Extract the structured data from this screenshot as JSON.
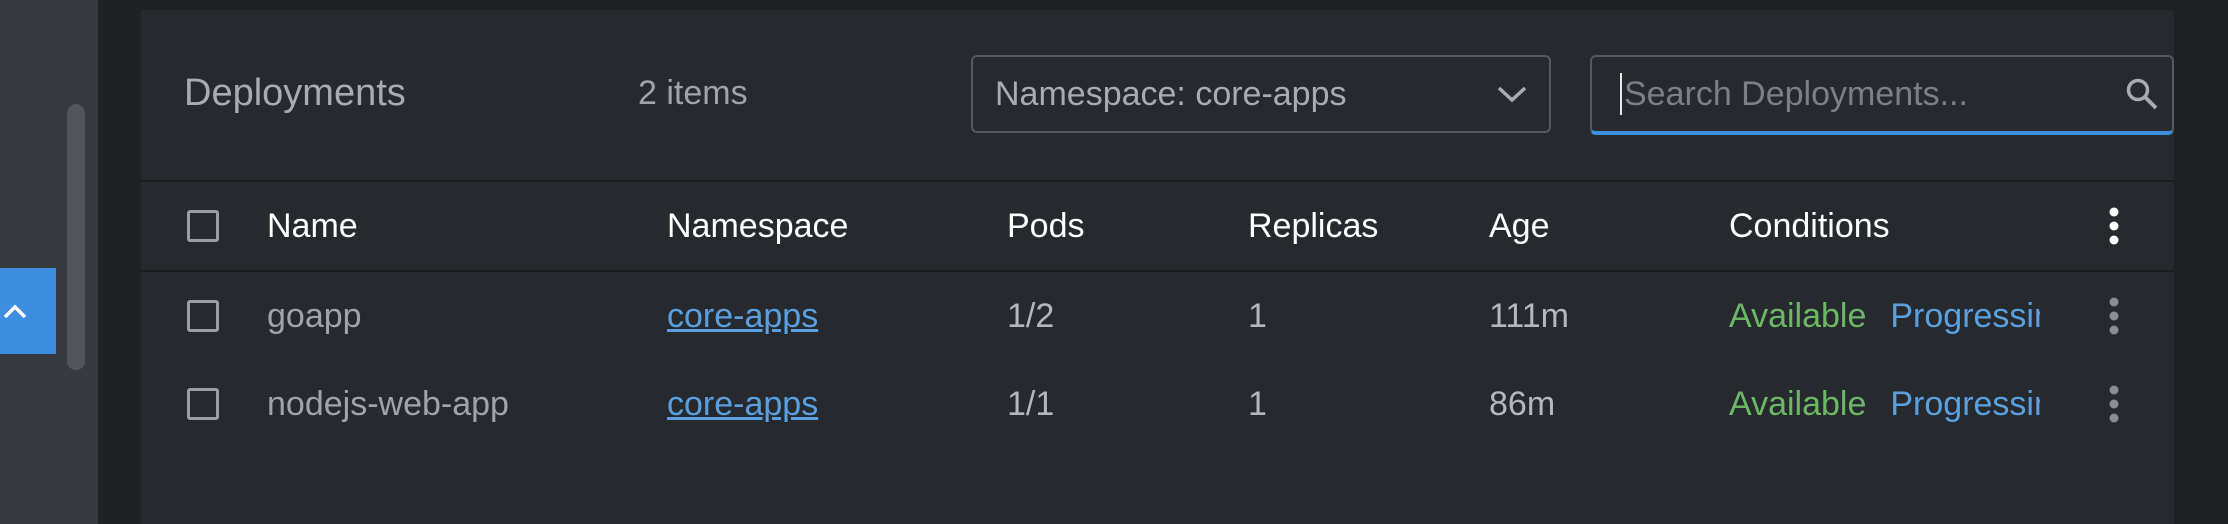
{
  "sidebar": {
    "toggle_icon": "chevron-up-icon"
  },
  "header": {
    "title": "Deployments",
    "count": "2 items",
    "namespace_select": "Namespace: core-apps",
    "search_placeholder": "Search Deployments..."
  },
  "table": {
    "columns": {
      "name": "Name",
      "namespace": "Namespace",
      "pods": "Pods",
      "replicas": "Replicas",
      "age": "Age",
      "conditions": "Conditions"
    },
    "rows": [
      {
        "name": "goapp",
        "namespace": "core-apps",
        "pods": "1/2",
        "replicas": "1",
        "age": "111m",
        "conditions": [
          "Available",
          "Progressing"
        ]
      },
      {
        "name": "nodejs-web-app",
        "namespace": "core-apps",
        "pods": "1/1",
        "replicas": "1",
        "age": "86m",
        "conditions": [
          "Available",
          "Progressing"
        ]
      }
    ]
  },
  "colors": {
    "accent": "#3d8ee0",
    "link": "#5aa0e0",
    "available": "#6cb865",
    "panel": "#262a2f"
  }
}
